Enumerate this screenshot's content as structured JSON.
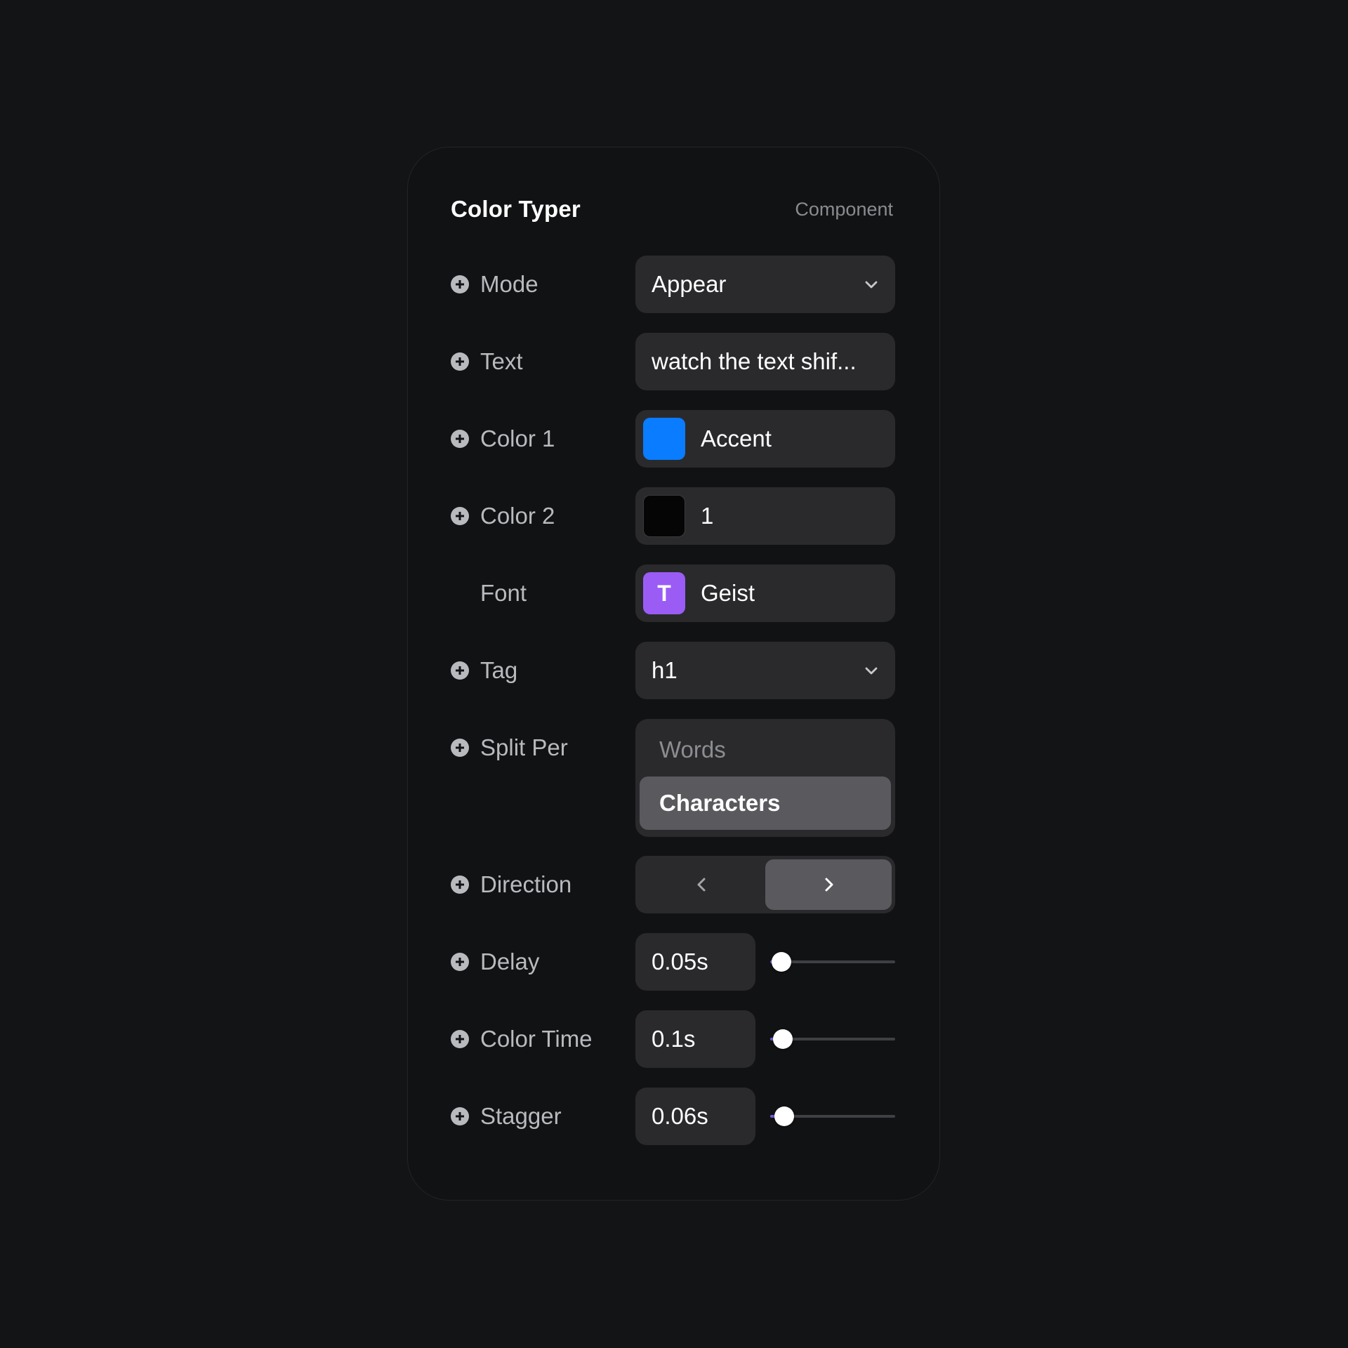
{
  "panel": {
    "title": "Color Typer",
    "subtitle": "Component"
  },
  "mode": {
    "label": "Mode",
    "value": "Appear",
    "icon": "chevron-down-icon"
  },
  "text": {
    "label": "Text",
    "value": "watch the text shif..."
  },
  "color1": {
    "label": "Color 1",
    "value": "Accent",
    "swatch": "#0a7cff"
  },
  "color2": {
    "label": "Color 2",
    "value": "1",
    "swatch": "#050505"
  },
  "font": {
    "label": "Font",
    "value": "Geist",
    "icon_letter": "T",
    "swatch": "#9a5cf5"
  },
  "tag": {
    "label": "Tag",
    "value": "h1",
    "icon": "chevron-down-icon"
  },
  "split_per": {
    "label": "Split Per",
    "options": [
      "Words",
      "Characters"
    ],
    "selected": "Characters"
  },
  "direction": {
    "label": "Direction",
    "options": [
      "chevron-left-icon",
      "chevron-right-icon"
    ],
    "selected": "chevron-right-icon"
  },
  "delay": {
    "label": "Delay",
    "value": "0.05s",
    "slider_fraction": 0.09
  },
  "color_time": {
    "label": "Color Time",
    "value": "0.1s",
    "slider_fraction": 0.1
  },
  "stagger": {
    "label": "Stagger",
    "value": "0.06s",
    "slider_fraction": 0.11
  },
  "icons": {
    "add": "plus-circle-icon"
  }
}
